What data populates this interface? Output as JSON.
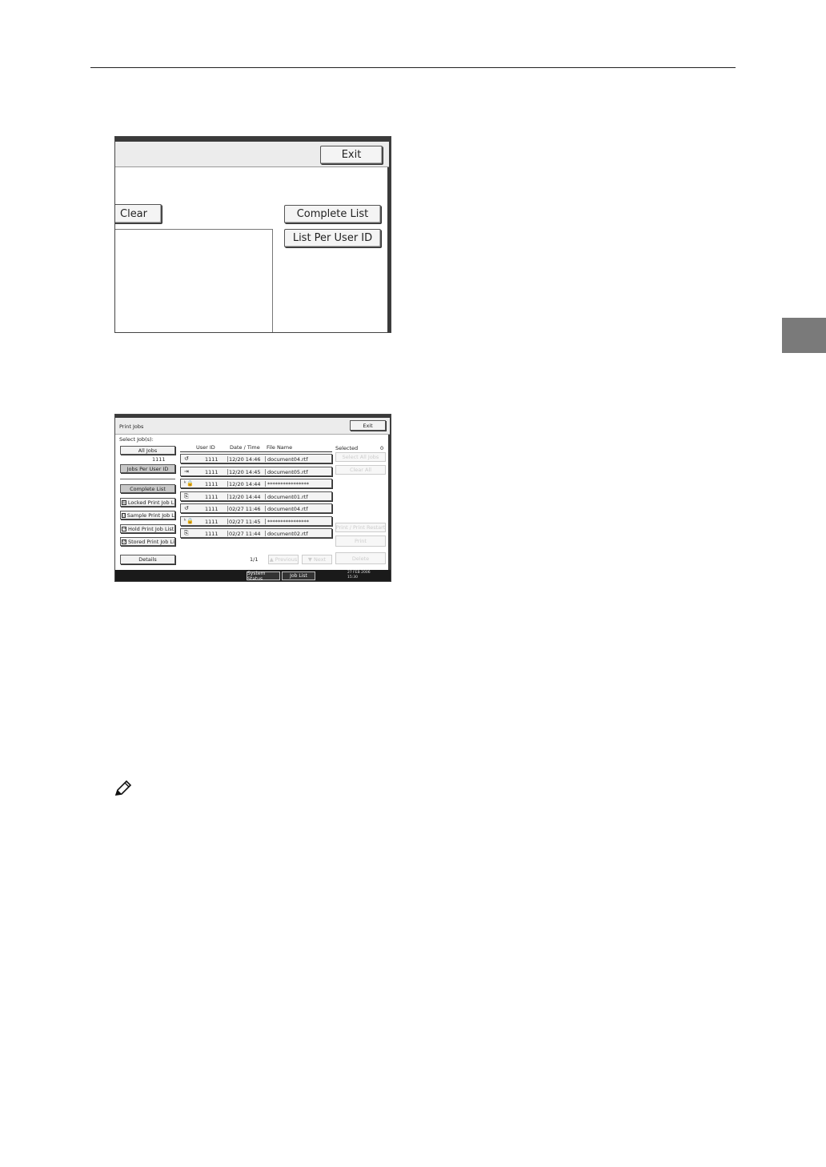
{
  "shot1": {
    "exit_label": "Exit",
    "clear_label": "Clear",
    "complete_list_label": "Complete List",
    "list_per_user_label": "List Per User ID"
  },
  "shot2": {
    "title": "Print Jobs",
    "exit_label": "Exit",
    "select_jobs_label": "Select Job(s):",
    "all_jobs_label": "All Jobs",
    "user_id_value": "1111",
    "jobs_per_user_label": "Jobs Per User ID",
    "complete_list_label": "Complete List",
    "locked_list_label": "Locked Print Job List",
    "sample_list_label": "Sample Print Job List",
    "hold_list_label": "Hold Print Job List",
    "stored_list_label": "Stored Print Job List",
    "details_label": "Details",
    "columns": {
      "user_id": "User ID",
      "date_time": "Date / Time",
      "file_name": "File Name"
    },
    "selected_label": "Selected",
    "selected_count": "0",
    "rows": [
      {
        "icon": "↺",
        "user": "1111",
        "date": "12/20 14:46",
        "file": "document04.rtf"
      },
      {
        "icon": "⇥",
        "user": "1111",
        "date": "12/20 14:45",
        "file": "document05.rtf"
      },
      {
        "icon": "ᵏ🔒",
        "user": "1111",
        "date": "12/20 14:44",
        "file": "****************"
      },
      {
        "icon": "⎘",
        "user": "1111",
        "date": "12/20 14:44",
        "file": "document01.rtf"
      },
      {
        "icon": "↺",
        "user": "1111",
        "date": "02/27 11:46",
        "file": "document04.rtf"
      },
      {
        "icon": "ᵏ🔒",
        "user": "1111",
        "date": "02/27 11:45",
        "file": "****************"
      },
      {
        "icon": "⎘",
        "user": "1111",
        "date": "02/27 11:44",
        "file": "document02.rtf"
      }
    ],
    "page_indicator": "1/1",
    "prev_label": "▲ Previous",
    "next_label": "▼ Next",
    "right_buttons": [
      "Select All Jobs",
      "Clear All",
      "Print / Print Restart",
      "Print",
      "Delete"
    ],
    "system_status_label": "System Status",
    "job_list_label": "Job List",
    "clock_date": "27 FEB 2006",
    "clock_time": "15:30"
  }
}
